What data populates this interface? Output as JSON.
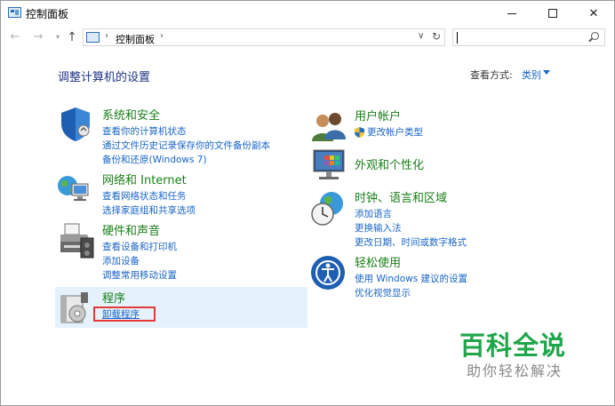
{
  "window": {
    "title": "控制面板",
    "controls": {
      "minimize": "minimize-icon",
      "maximize": "maximize-icon",
      "close": "close-icon"
    }
  },
  "navigation": {
    "back_icon": "arrow-left-icon",
    "forward_icon": "arrow-right-icon",
    "up_icon": "arrow-up-icon",
    "address_path": [
      "控制面板"
    ],
    "search_value": ""
  },
  "header": {
    "title": "调整计算机的设置",
    "view_by_label": "查看方式:",
    "view_by_value": "类别"
  },
  "left_categories": [
    {
      "title": "系统和安全",
      "icon": "shield-icon",
      "links": [
        "查看你的计算机状态",
        "通过文件历史记录保存你的文件备份副本",
        "备份和还原(Windows 7)"
      ]
    },
    {
      "title": "网络和 Internet",
      "icon": "network-globe-icon",
      "links": [
        "查看网络状态和任务",
        "选择家庭组和共享选项"
      ]
    },
    {
      "title": "硬件和声音",
      "icon": "printer-icon",
      "links": [
        "查看设备和打印机",
        "添加设备",
        "调整常用移动设置"
      ]
    },
    {
      "title": "程序",
      "icon": "programs-icon",
      "links": [
        "卸载程序"
      ],
      "highlighted": true
    }
  ],
  "right_categories": [
    {
      "title": "用户帐户",
      "icon": "users-icon",
      "links": [
        "更改帐户类型"
      ]
    },
    {
      "title": "外观和个性化",
      "icon": "display-palette-icon",
      "links": []
    },
    {
      "title": "时钟、语言和区域",
      "icon": "clock-globe-icon",
      "links": [
        "添加语言",
        "更换输入法",
        "更改日期、时间或数字格式"
      ]
    },
    {
      "title": "轻松使用",
      "icon": "accessibility-icon",
      "links": [
        "使用 Windows 建议的设置",
        "优化视觉显示"
      ]
    }
  ],
  "watermark": {
    "line1": "百科全说",
    "line2": "助你轻松解决"
  },
  "colors": {
    "category_title": "#1a7e1a",
    "link": "#1a65c6",
    "page_title": "#1e3287",
    "highlight_bg": "#e5f1fb",
    "annotation_red": "#e53a3a",
    "watermark_green": "#1fa64a"
  }
}
